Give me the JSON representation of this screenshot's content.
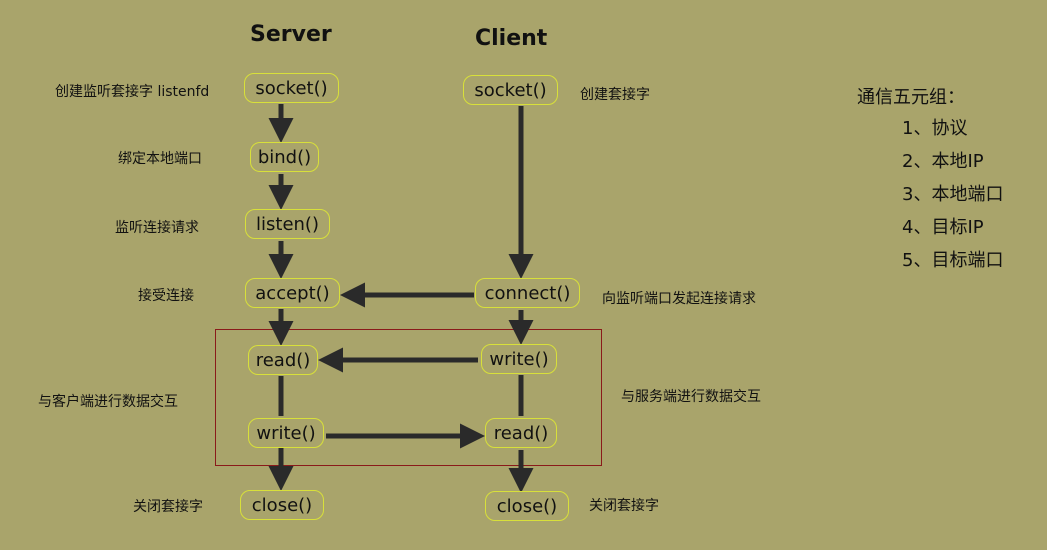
{
  "headers": {
    "server": "Server",
    "client": "Client"
  },
  "server_steps": {
    "socket": "socket()",
    "bind": "bind()",
    "listen": "listen()",
    "accept": "accept()",
    "read": "read()",
    "write": "write()",
    "close": "close()"
  },
  "client_steps": {
    "socket": "socket()",
    "connect": "connect()",
    "write": "write()",
    "read": "read()",
    "close": "close()"
  },
  "server_notes": {
    "socket": "创建监听套接字 listenfd",
    "bind": "绑定本地端口",
    "listen": "监听连接请求",
    "accept": "接受连接",
    "exchange": "与客户端进行数据交互",
    "close": "关闭套接字"
  },
  "client_notes": {
    "socket": "创建套接字",
    "connect": "向监听端口发起连接请求",
    "exchange": "与服务端进行数据交互",
    "close": "关闭套接字"
  },
  "tuple": {
    "title": "通信五元组：",
    "items": [
      "1、协议",
      "2、本地IP",
      "3、本地端口",
      "4、目标IP",
      "5、目标端口"
    ]
  },
  "colors": {
    "background": "#a9a46b",
    "box_border": "#d8e03a",
    "arrow": "#2a2a2a",
    "group_border": "#8a1a1a"
  }
}
